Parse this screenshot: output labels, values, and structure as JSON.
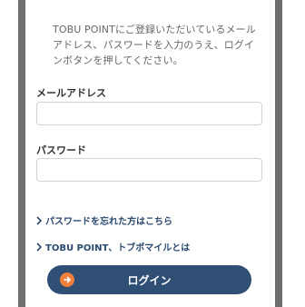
{
  "intro": {
    "text": "TOBU POINTにご登録いただいているメールアドレス、パスワードを入力のうえ、ログインボタンを押してください。"
  },
  "form": {
    "email_label": "メールアドレス",
    "email_value": "",
    "password_label": "パスワード",
    "password_value": ""
  },
  "links": {
    "forgot_password": "パスワードを忘れた方はこちら",
    "about": "TOBU POINT、トブポマイルとは"
  },
  "login": {
    "label": "ログイン",
    "icon": "arrow-right-circle-icon"
  },
  "colors": {
    "side_bar": "#6f6f6f",
    "button": "#2f4f75",
    "button_icon": "#ef7f3a",
    "link": "#2b4a6f"
  }
}
